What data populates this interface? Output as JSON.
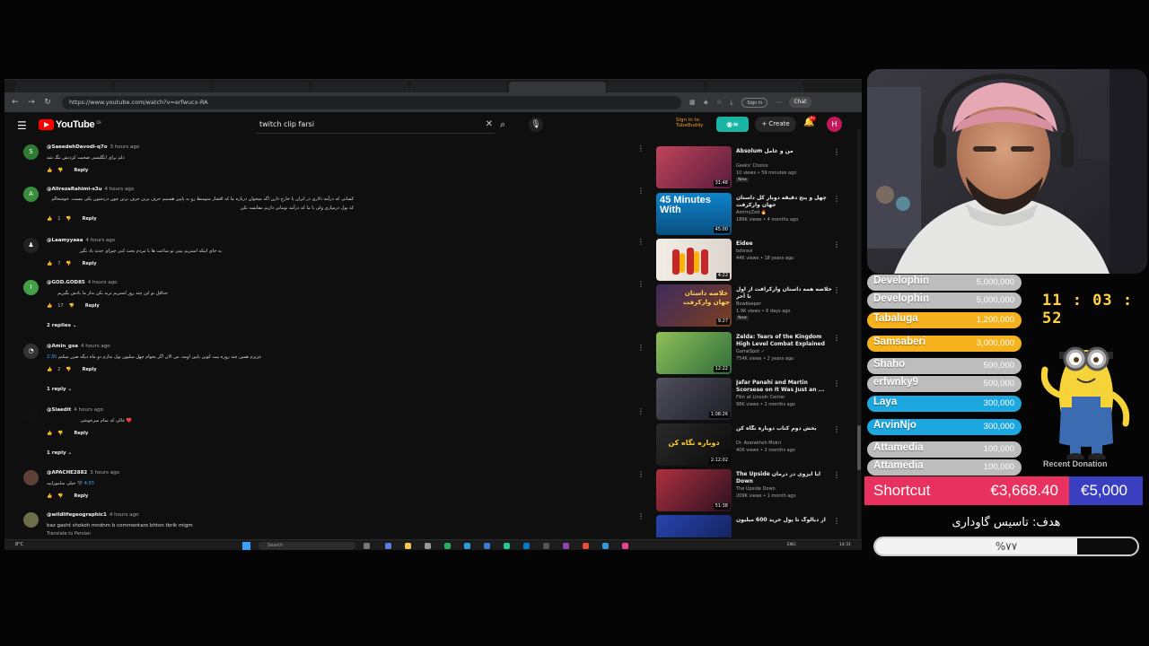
{
  "browser": {
    "tabs": [
      "",
      "",
      "",
      "",
      "",
      "",
      "",
      ""
    ],
    "url": "https://www.youtube.com/watch?v=erfwucx-RA",
    "signin_chip": "Sign in",
    "chat_chip": "Chat"
  },
  "youtube": {
    "logo_text": "YouTube",
    "logo_cc": "DE",
    "search_query": "twitch clip farsi",
    "tubebuddy_line1": "Sign in to",
    "tubebuddy_line2": "TubeBuddy",
    "create_label": "+ Create",
    "notification_count": "9+",
    "avatar_letter": "H"
  },
  "comments": [
    {
      "author": "@SaeedehDavodi-q7o",
      "time": "3 hours ago",
      "text": "دلم برای انگلیسی صحبت کردنش تنگ شد",
      "likes": "",
      "reply": "Reply",
      "avatar": "S",
      "avatar_color": "#2e7d32"
    },
    {
      "author": "@AlirezaRahimi-s3u",
      "time": "4 hours ago",
      "text": "کسانی که درآمد دلاری در ایران یا خارج دارن اگه میخوان درباره ما که اقشار متوسط رو به پایین هستیم حرف بزنن حرف نزنن چون دردشون یکی نیست. خوشحالم که پول درمیاری ولی با ما که درآمد تومانی داریم مقایسه نکن",
      "likes": "1",
      "reply": "Reply",
      "avatar": "A",
      "avatar_color": "#388e3c"
    },
    {
      "author": "@Laamyyaaa",
      "time": "4 hours ago",
      "text": "به جای اینکه استریم بینی تو ساعت ها با مردم بحث کنی چیزای جدید یاد بگیر",
      "likes": "7",
      "reply": "Reply",
      "avatar": "",
      "avatar_color": "#222222"
    },
    {
      "author": "@GOD.GOD85",
      "time": "4 hours ago",
      "text": "حداقل تو این چند روز استریم ترید بکن بذار ما یادش بگیریم",
      "likes": "17",
      "reply": "Reply",
      "avatar": "I",
      "avatar_color": "#43a047",
      "replies": "2 replies"
    },
    {
      "author": "@Amin_gsa",
      "time": "4 hours ago",
      "text": "عزیزم همین چند روزه بیت کوین پایین اومد، من الان اگر بخوام چهل میلیون پول بذارم دو ماه دیگه ضرر میکنم",
      "timestamp": "2:30",
      "likes": "2",
      "reply": "Reply",
      "avatar": "",
      "avatar_color": "#333333",
      "replies": "1 reply"
    },
    {
      "author": "@Siaedit",
      "time": "4 hours ago",
      "text": "❤️ عالی که سام سرخوشی",
      "likes": "",
      "reply": "Reply",
      "avatar": "",
      "avatar_color": "#111111",
      "replies": "1 reply"
    },
    {
      "author": "@APACHE2882",
      "time": "3 hours ago",
      "text": "🖤 خیلی ساموراییه",
      "timestamp": "4:55",
      "likes": "",
      "reply": "Reply",
      "avatar": "",
      "avatar_color": "#5d4037"
    },
    {
      "author": "@wildlifegeographic1",
      "time": "4 hours ago",
      "text": "baz gasht shokoh mndnm b commentaro bhton tbrik migm",
      "likes": "",
      "reply": "Translate to Persian",
      "avatar": "",
      "avatar_color": "#6d6d4a"
    }
  ],
  "sidebar": [
    {
      "title": "Absolum من و عامل",
      "channel": "Geeks' Choice",
      "meta": "10 views • 59 minutes ago",
      "badge": "New",
      "duration": "31:48",
      "thumb_color": "#8a2d3d"
    },
    {
      "title": "چهل و پنج دقیقه دوبار کل داستان جهان وارکرفت",
      "channel": "AmirryZed 🔥",
      "meta": "186K views • 4 months ago",
      "badge": "",
      "duration": "45:00",
      "thumb_color": "#0b7fc4",
      "thumb_text": "45 Minutes With"
    },
    {
      "title": "Eidee",
      "channel": "bdsravi",
      "meta": "44K views • 18 years ago",
      "badge": "",
      "duration": "4:22",
      "thumb_color": "#e9e3dd"
    },
    {
      "title": "خلاصه همه داستان وارکرافت از اول تا آخر",
      "channel": "BowKeeper",
      "meta": "1.9K views • 6 days ago",
      "badge": "New",
      "duration": "9:27",
      "thumb_color": "#5b2f7a",
      "thumb_text": "خلاصه داستان جهان وارکرفت"
    },
    {
      "title": "Zelda: Tears of the Kingdom High Level Combat Explained",
      "channel": "GameSpot ✓",
      "meta": "754K views • 2 years ago",
      "badge": "",
      "duration": "12:22",
      "thumb_color": "#6aa04a"
    },
    {
      "title": "Jafar Panahi and Martin Scorsese on It Was Just an ...",
      "channel": "Film at Lincoln Center",
      "meta": "98K views • 2 months ago",
      "badge": "",
      "duration": "1:08:26",
      "thumb_color": "#3a3a4a"
    },
    {
      "title": "بخش دوم کتاب دوباره نگاه کن",
      "channel": "Dr. Azarakhsh Mokri",
      "meta": "40K views • 2 months ago",
      "badge": "",
      "duration": "2:12:02",
      "thumb_color": "#1b1b1b",
      "thumb_text": "دوباره نگاه کن"
    },
    {
      "title": "آیا ایزوی دز درمان The Upside Down",
      "channel": "The Upside Down",
      "meta": "209K views • 1 month ago",
      "badge": "",
      "duration": "51:38",
      "thumb_color": "#7a2030"
    },
    {
      "title": "از دیالوگ تا پول خرید 600 میلیون",
      "channel": "",
      "meta": "",
      "badge": "",
      "duration": "",
      "thumb_color": "#1d3a8a"
    }
  ],
  "taskbar": {
    "weather": "8°C",
    "search": "Search",
    "lang": "ENG",
    "clock": "14:31"
  },
  "donors": [
    {
      "name": "Develophin",
      "amount": "5,000,000",
      "color": "#bdbdbd"
    },
    {
      "name": "Develophin",
      "amount": "5,000,000",
      "color": "#bdbdbd"
    },
    {
      "name": "Tabaluga",
      "amount": "1,200,000",
      "color": "#f5b21c"
    },
    {
      "name": "Samsaberi",
      "amount": "3,000,000",
      "color": "#f5b21c"
    },
    {
      "name": "Shaho",
      "amount": "500,000",
      "color": "#bdbdbd"
    },
    {
      "name": "erfwnky9",
      "amount": "500,000",
      "color": "#bdbdbd"
    },
    {
      "name": "Laya",
      "amount": "300,000",
      "color": "#1da7e0"
    },
    {
      "name": "ArvinNjo",
      "amount": "300,000",
      "color": "#1da7e0"
    },
    {
      "name": "Attamedia",
      "amount": "100,000",
      "color": "#bdbdbd"
    },
    {
      "name": "Attamedia",
      "amount": "100,000",
      "color": "#bdbdbd"
    }
  ],
  "timer": "11 : 03 : 52",
  "overlay_partial": "Recent Donation",
  "goal": {
    "current_name": "Shortcut",
    "current_amount": "€3,668.40",
    "target_amount": "€5,000",
    "label": "هدف: تاسیس گاوداری",
    "progress_text": "%۷۷",
    "progress": 0.77
  }
}
